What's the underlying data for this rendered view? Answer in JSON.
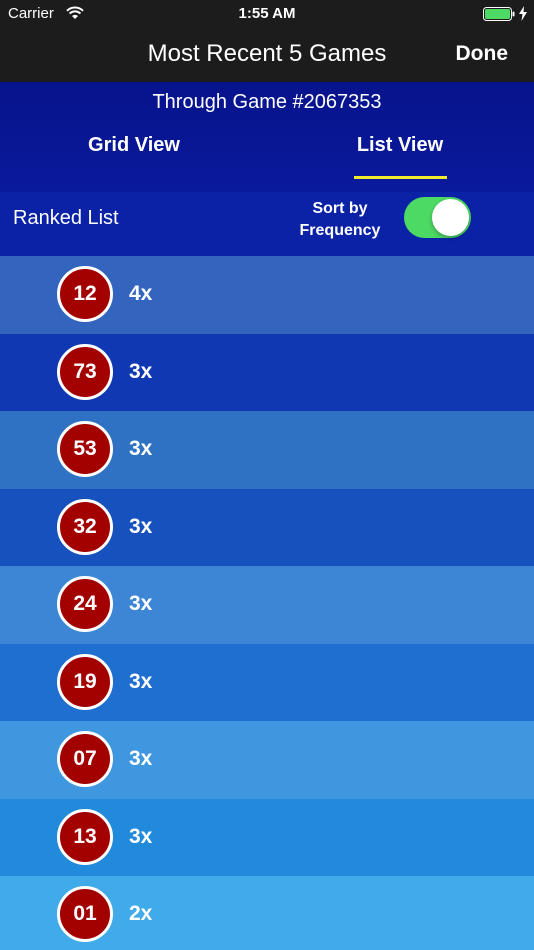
{
  "status_bar": {
    "carrier": "Carrier",
    "time": "1:55 AM"
  },
  "nav": {
    "title": "Most Recent 5 Games",
    "done_label": "Done"
  },
  "header": {
    "subtitle": "Through Game #2067353",
    "tabs": [
      {
        "label": "Grid View",
        "selected": false
      },
      {
        "label": "List View",
        "selected": true
      }
    ]
  },
  "sort_bar": {
    "title": "Ranked List",
    "toggle_label_line1": "Sort by",
    "toggle_label_line2": "Frequency",
    "toggle_on": true
  },
  "colors": {
    "ball": "#a30000",
    "toggle_on": "#4cd964",
    "tab_underline": "#f2ea2c"
  },
  "rows": [
    {
      "number": "12",
      "count": "4x",
      "bg": "#3465be"
    },
    {
      "number": "73",
      "count": "3x",
      "bg": "#1038b3"
    },
    {
      "number": "53",
      "count": "3x",
      "bg": "#2f72c4"
    },
    {
      "number": "32",
      "count": "3x",
      "bg": "#1651bd"
    },
    {
      "number": "24",
      "count": "3x",
      "bg": "#3d86d5"
    },
    {
      "number": "19",
      "count": "3x",
      "bg": "#1e6fcf"
    },
    {
      "number": "07",
      "count": "3x",
      "bg": "#3f97e0"
    },
    {
      "number": "13",
      "count": "3x",
      "bg": "#228ada"
    },
    {
      "number": "01",
      "count": "2x",
      "bg": "#41aae8"
    }
  ]
}
